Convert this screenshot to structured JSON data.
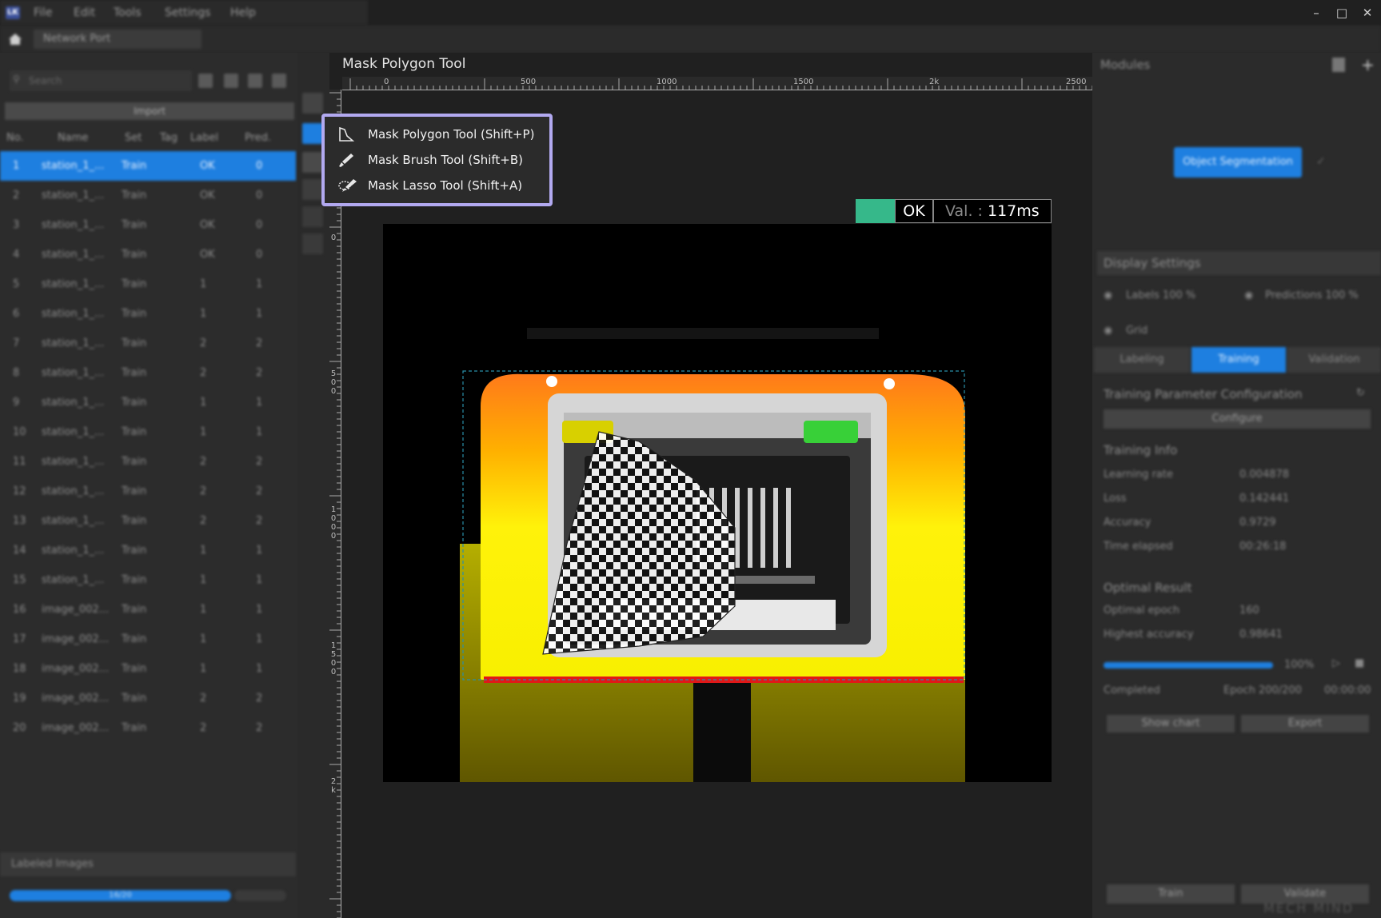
{
  "menubar": {
    "logo_text": "LK",
    "items": [
      "File",
      "Edit",
      "Tools",
      "Settings",
      "Help"
    ],
    "window_controls": [
      "minimize-icon",
      "maximize-icon",
      "close-icon"
    ]
  },
  "project_tab": {
    "label": "Network Port"
  },
  "left_panel": {
    "search_placeholder": "Search",
    "import_label": "Import",
    "columns": [
      "No.",
      "Name",
      "Set",
      "Tag",
      "Label",
      "Pred."
    ],
    "rows": [
      {
        "no": "1",
        "name": "station_1_...",
        "set": "Train",
        "label": "OK",
        "pred": "0",
        "selected": true
      },
      {
        "no": "2",
        "name": "station_1_...",
        "set": "Train",
        "label": "OK",
        "pred": "0"
      },
      {
        "no": "3",
        "name": "station_1_...",
        "set": "Train",
        "label": "OK",
        "pred": "0"
      },
      {
        "no": "4",
        "name": "station_1_...",
        "set": "Train",
        "label": "OK",
        "pred": "0"
      },
      {
        "no": "5",
        "name": "station_1_...",
        "set": "Train",
        "label": "1",
        "pred": "1"
      },
      {
        "no": "6",
        "name": "station_1_...",
        "set": "Train",
        "label": "1",
        "pred": "1"
      },
      {
        "no": "7",
        "name": "station_1_...",
        "set": "Train",
        "label": "2",
        "pred": "2"
      },
      {
        "no": "8",
        "name": "station_1_...",
        "set": "Train",
        "label": "2",
        "pred": "2"
      },
      {
        "no": "9",
        "name": "station_1_...",
        "set": "Train",
        "label": "1",
        "pred": "1"
      },
      {
        "no": "10",
        "name": "station_1_...",
        "set": "Train",
        "label": "1",
        "pred": "1"
      },
      {
        "no": "11",
        "name": "station_1_...",
        "set": "Train",
        "label": "2",
        "pred": "2"
      },
      {
        "no": "12",
        "name": "station_1_...",
        "set": "Train",
        "label": "2",
        "pred": "2"
      },
      {
        "no": "13",
        "name": "station_1_...",
        "set": "Train",
        "label": "2",
        "pred": "2"
      },
      {
        "no": "14",
        "name": "station_1_...",
        "set": "Train",
        "label": "1",
        "pred": "1"
      },
      {
        "no": "15",
        "name": "station_1_...",
        "set": "Train",
        "label": "1",
        "pred": "1"
      },
      {
        "no": "16",
        "name": "image_002...",
        "set": "Train",
        "label": "1",
        "pred": "1"
      },
      {
        "no": "17",
        "name": "image_002...",
        "set": "Train",
        "label": "1",
        "pred": "1"
      },
      {
        "no": "18",
        "name": "image_002...",
        "set": "Train",
        "label": "1",
        "pred": "1"
      },
      {
        "no": "19",
        "name": "image_002...",
        "set": "Train",
        "label": "2",
        "pred": "2"
      },
      {
        "no": "20",
        "name": "image_002...",
        "set": "Train",
        "label": "2",
        "pred": "2"
      }
    ],
    "footer_label": "Labeled Images",
    "progress_text": "16/20",
    "progress_fraction": 0.8
  },
  "canvas": {
    "title": "Mask Polygon Tool",
    "ruler_top": [
      "0",
      "500",
      "1000",
      "1500",
      "2k",
      "2500"
    ],
    "ruler_left": [
      "0",
      "500",
      "1000",
      "1500",
      "2k"
    ],
    "status": {
      "result": "OK",
      "val_label": "Val. :",
      "val_time": "117ms",
      "color": "#36b88a"
    }
  },
  "tool_menu": {
    "items": [
      {
        "label": "Mask Polygon Tool (Shift+P)",
        "icon": "polygon-tool-icon"
      },
      {
        "label": "Mask Brush Tool (Shift+B)",
        "icon": "brush-tool-icon"
      },
      {
        "label": "Mask Lasso Tool (Shift+A)",
        "icon": "lasso-tool-icon"
      }
    ],
    "highlight_color": "#b2a9f0"
  },
  "right_panel": {
    "modules_title": "Modules",
    "module_node": "Object Segmentation",
    "display_settings": "Display Settings",
    "labels_opacity": "Labels 100 %",
    "predictions_opacity": "Predictions 100 %",
    "grid_label": "Grid",
    "tabs": [
      "Labeling",
      "Training",
      "Validation"
    ],
    "active_tab": "Training",
    "training_param_config": "Training Parameter Configuration",
    "configure_btn": "Configure",
    "training_info": "Training Info",
    "info_rows": [
      {
        "k": "Learning rate",
        "v": "0.004878"
      },
      {
        "k": "Loss",
        "v": "0.142441"
      },
      {
        "k": "Accuracy",
        "v": "0.9729"
      },
      {
        "k": "Time elapsed",
        "v": "00:26:18"
      }
    ],
    "optimal_result": "Optimal Result",
    "optimal_rows": [
      {
        "k": "Optimal epoch",
        "v": "160"
      },
      {
        "k": "Highest accuracy",
        "v": "0.98641"
      }
    ],
    "progress_percent": "100%",
    "progress_fraction": 1.0,
    "completed_label": "Completed",
    "epochs_label": "Epoch 200/200",
    "completed_time": "00:00:00",
    "show_chart_btn": "Show chart",
    "export_btn": "Export",
    "train_btn": "Train",
    "validate_btn": "Validate",
    "watermark": "MECH MIND"
  }
}
